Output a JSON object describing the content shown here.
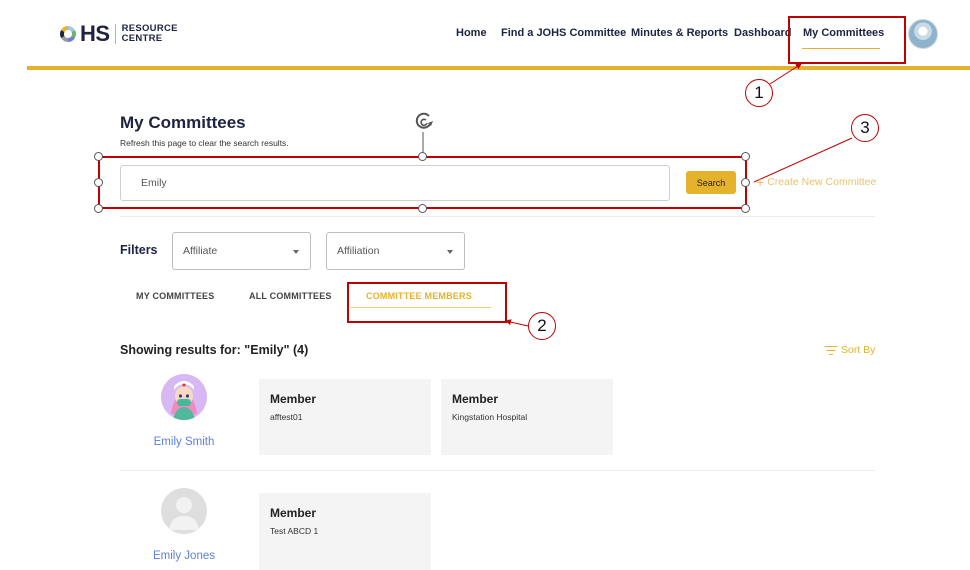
{
  "header": {
    "logo": {
      "mark": "HS",
      "line1": "RESOURCE",
      "line2": "CENTRE"
    },
    "nav": [
      {
        "label": "Home",
        "active": false
      },
      {
        "label": "Find a JOHS Committee",
        "active": false
      },
      {
        "label": "Minutes & Reports",
        "active": false
      },
      {
        "label": "Dashboard",
        "active": false
      },
      {
        "label": "My Committees",
        "active": true
      }
    ],
    "avatar_icon": "user-profile-photo"
  },
  "colors": {
    "accent": "#e4b22b",
    "brand_navy": "#1d2340",
    "link_blue": "#5a7fe0",
    "annotation_red": "#c00000"
  },
  "main": {
    "title": "My Committees",
    "subtitle": "Refresh this page to clear the search results.",
    "search": {
      "value": "Emily",
      "button_label": "Search"
    },
    "create_link": {
      "icon": "plus-icon",
      "label": "Create New Committee"
    },
    "filters": {
      "label": "Filters",
      "selects": [
        {
          "placeholder": "Affiliate"
        },
        {
          "placeholder": "Affiliation"
        }
      ]
    },
    "tabs": [
      {
        "label": "MY COMMITTEES",
        "active": false
      },
      {
        "label": "ALL COMMITTEES",
        "active": false
      },
      {
        "label": "COMMITTEE MEMBERS",
        "active": true
      }
    ],
    "results_label": "Showing results for: \"Emily\" (4)",
    "sort_label": "Sort By",
    "results": [
      {
        "name": "Emily Smith",
        "avatar": "nurse-illustration",
        "memberships": [
          {
            "role": "Member",
            "org": "afftest01"
          },
          {
            "role": "Member",
            "org": "Kingstation Hospital"
          }
        ]
      },
      {
        "name": "Emily Jones",
        "avatar": "default-user-silhouette",
        "memberships": [
          {
            "role": "Member",
            "org": "Test ABCD 1"
          }
        ]
      }
    ]
  },
  "annotations": [
    {
      "number": "1",
      "target": "My Committees nav item"
    },
    {
      "number": "2",
      "target": "COMMITTEE MEMBERS tab"
    },
    {
      "number": "3",
      "target": "Search bar"
    }
  ]
}
